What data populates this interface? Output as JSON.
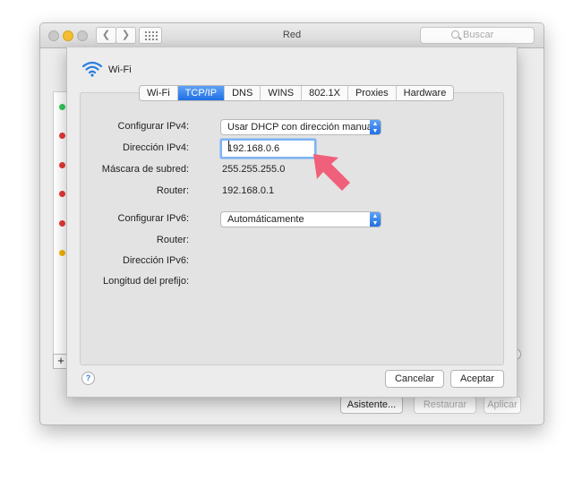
{
  "window": {
    "title": "Red",
    "search_placeholder": "Buscar"
  },
  "background": {
    "services_status_colors": [
      "#34c759",
      "#e53935",
      "#e53935",
      "#e53935",
      "#e53935",
      "#e53935",
      "#f4b400"
    ],
    "add_label": "+",
    "buttons": {
      "assistant": "Asistente...",
      "restore": "Restaurar",
      "apply": "Aplicar"
    }
  },
  "sheet": {
    "title": "Wi-Fi",
    "tabs": [
      {
        "label": "Wi-Fi",
        "active": false
      },
      {
        "label": "TCP/IP",
        "active": true
      },
      {
        "label": "DNS",
        "active": false
      },
      {
        "label": "WINS",
        "active": false
      },
      {
        "label": "802.1X",
        "active": false
      },
      {
        "label": "Proxies",
        "active": false
      },
      {
        "label": "Hardware",
        "active": false
      }
    ],
    "fields": {
      "configure_ipv4_label": "Configurar IPv4:",
      "configure_ipv4_value": "Usar DHCP con dirección manual",
      "ipv4_address_label": "Dirección IPv4:",
      "ipv4_address_value": "192.168.0.6",
      "subnet_mask_label": "Máscara de subred:",
      "subnet_mask_value": "255.255.255.0",
      "router_label": "Router:",
      "router_value": "192.168.0.1",
      "configure_ipv6_label": "Configurar IPv6:",
      "configure_ipv6_value": "Automáticamente",
      "router6_label": "Router:",
      "ipv6_address_label": "Dirección IPv6:",
      "prefix_length_label": "Longitud del prefijo:"
    },
    "help_label": "?",
    "cancel_label": "Cancelar",
    "accept_label": "Aceptar"
  },
  "colors": {
    "accent": "#1f6fe6",
    "arrow": "#f0607a"
  }
}
